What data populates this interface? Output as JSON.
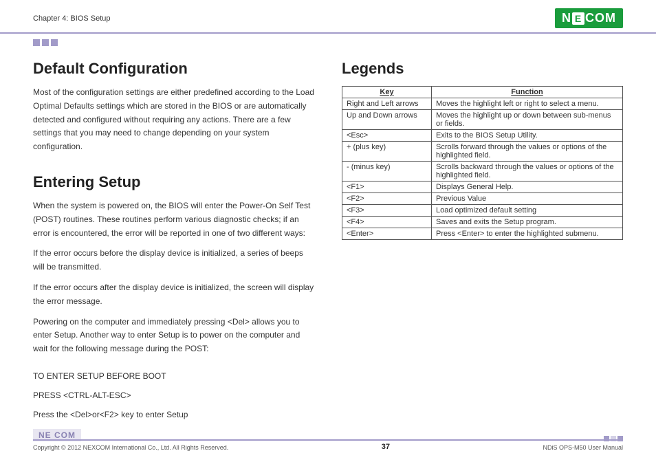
{
  "header": {
    "chapter": "Chapter 4: BIOS Setup",
    "logo_left": "N",
    "logo_e": "E",
    "logo_right": "COM"
  },
  "left": {
    "h1_default": "Default Configuration",
    "p_default": "Most of the configuration settings are either predefined according to the Load Optimal Defaults settings which are stored in the BIOS or are automatically detected and configured without requiring any actions. There are a few settings that you may need to change depending on your system configuration.",
    "h1_entering": "Entering Setup",
    "p_entering_1": "When the system is powered on, the BIOS will enter the Power-On Self Test (POST) routines. These routines perform various diagnostic checks; if an error is encountered, the error will be reported in one of two different ways:",
    "p_entering_2": "If the error occurs before the display device is initialized, a series of beeps will be transmitted.",
    "p_entering_3": "If the error occurs after the display device is initialized, the screen will display the error message.",
    "p_entering_4": "Powering on the computer and immediately pressing <Del> allows you to enter Setup. Another way to enter Setup is to power on the computer and wait for the following message during the POST:",
    "setup_l1": "TO ENTER SETUP BEFORE BOOT",
    "setup_l2": "PRESS <CTRL-ALT-ESC>",
    "setup_l3": "Press the <Del>or<F2> key to enter Setup"
  },
  "right": {
    "h1_legends": "Legends",
    "th_key": "Key",
    "th_function": "Function",
    "rows": [
      {
        "key": "Right and Left arrows",
        "fn": "Moves the highlight left or right to select a menu."
      },
      {
        "key": "Up and Down arrows",
        "fn": "Moves the highlight up or down between sub-menus or fields."
      },
      {
        "key": "<Esc>",
        "fn": "Exits to the BIOS Setup Utility."
      },
      {
        "key": "+ (plus key)",
        "fn": "Scrolls forward through the values or options of the highlighted field."
      },
      {
        "key": "- (minus key)",
        "fn": "Scrolls backward through the values or options of the highlighted field."
      },
      {
        "key": "<F1>",
        "fn": "Displays General Help."
      },
      {
        "key": "<F2>",
        "fn": "Previous Value"
      },
      {
        "key": "<F3>",
        "fn": "Load optimized default setting"
      },
      {
        "key": "<F4>",
        "fn": "Saves and exits the Setup program."
      },
      {
        "key": "<Enter>",
        "fn": "Press <Enter> to enter the highlighted submenu."
      }
    ]
  },
  "footer": {
    "copyright": "Copyright © 2012 NEXCOM International Co., Ltd. All Rights Reserved.",
    "page": "37",
    "manual": "NDiS OPS-M50 User Manual",
    "logo": "NE COM"
  }
}
